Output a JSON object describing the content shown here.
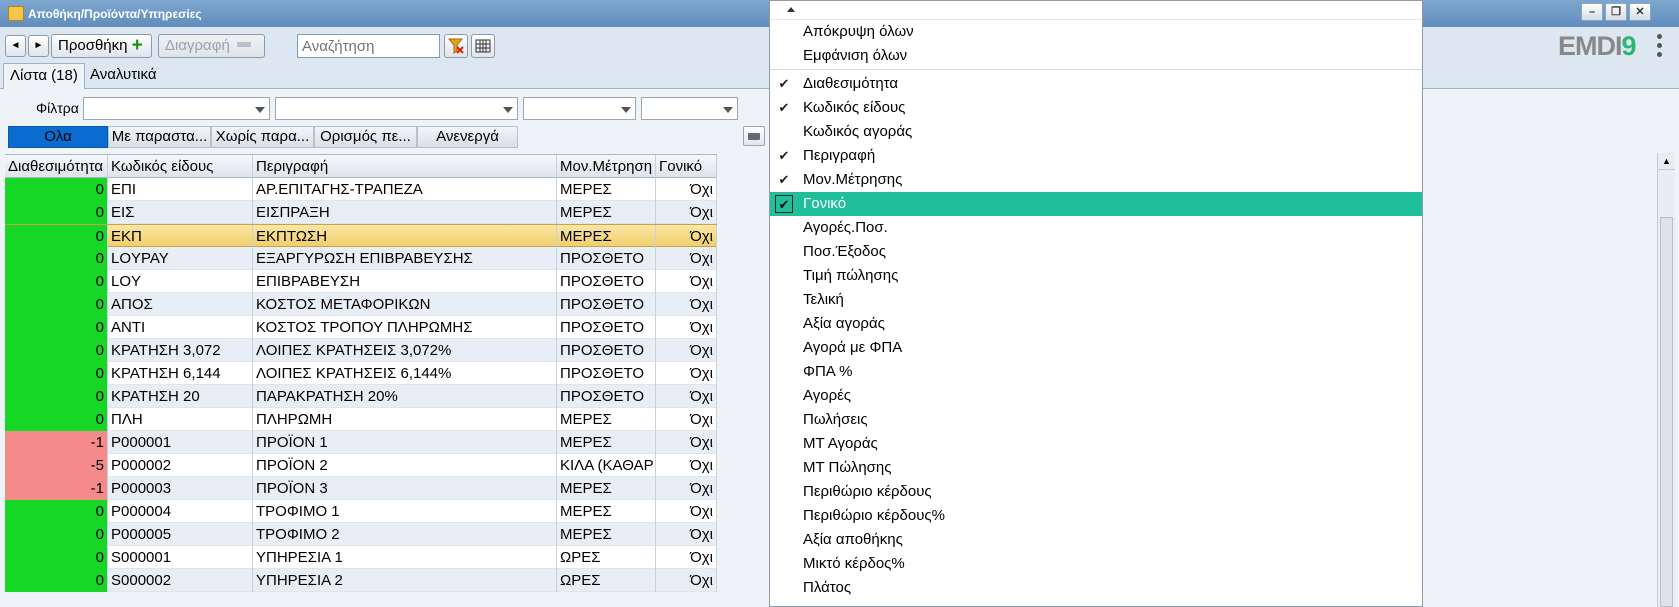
{
  "window": {
    "title": "Αποθήκη/Προϊόντα/Υπηρεσίες"
  },
  "toolbar": {
    "prev_label": "◄",
    "next_label": "►",
    "add_label": "Προσθήκη",
    "delete_label": "Διαγραφή",
    "search_placeholder": "Αναζήτηση"
  },
  "logo": {
    "text_a": "EMDI",
    "text_b": "9"
  },
  "tabs": [
    {
      "label": "Λίστα (18)"
    },
    {
      "label": "Αναλυτικά"
    }
  ],
  "filters": {
    "label": "Φίλτρα",
    "segments": [
      {
        "label": "Ολα"
      },
      {
        "label": "Με παραστα..."
      },
      {
        "label": "Χωρίς παρα..."
      },
      {
        "label": "Ορισμός πε..."
      },
      {
        "label": "Ανενεργά"
      }
    ]
  },
  "grid": {
    "columns": [
      "Διαθεσιμότητα",
      "Κωδικός είδους",
      "Περιγραφή",
      "Μον.Μέτρηση",
      "Γονικό"
    ],
    "rows": [
      {
        "avail": "0",
        "code": "ΕΠΙ",
        "desc": "ΑΡ.ΕΠΙΤΑΓΗΣ-ΤΡΑΠΕΖΑ",
        "unit": "ΜΕΡΕΣ",
        "parent": "Όχι"
      },
      {
        "avail": "0",
        "code": "ΕΙΣ",
        "desc": "ΕΙΣΠΡΑΞΗ",
        "unit": "ΜΕΡΕΣ",
        "parent": "Όχι"
      },
      {
        "avail": "0",
        "code": "ΕΚΠ",
        "desc": "ΕΚΠΤΩΣΗ",
        "unit": "ΜΕΡΕΣ",
        "parent": "Όχι"
      },
      {
        "avail": "0",
        "code": "LOYPAY",
        "desc": "ΕΞΑΡΓΥΡΩΣΗ ΕΠΙΒΡΑΒΕΥΣΗΣ",
        "unit": "ΠΡΟΣΘΕΤΟ",
        "parent": "Όχι"
      },
      {
        "avail": "0",
        "code": "LOY",
        "desc": "ΕΠΙΒΡΑΒΕΥΣΗ",
        "unit": "ΠΡΟΣΘΕΤΟ",
        "parent": "Όχι"
      },
      {
        "avail": "0",
        "code": "ΑΠΟΣ",
        "desc": "ΚΟΣΤΟΣ ΜΕΤΑΦΟΡΙΚΩΝ",
        "unit": "ΠΡΟΣΘΕΤΟ",
        "parent": "Όχι"
      },
      {
        "avail": "0",
        "code": "ΑΝΤΙ",
        "desc": "ΚΟΣΤΟΣ ΤΡΟΠΟΥ ΠΛΗΡΩΜΗΣ",
        "unit": "ΠΡΟΣΘΕΤΟ",
        "parent": "Όχι"
      },
      {
        "avail": "0",
        "code": "ΚΡΑΤΗΣΗ 3,072",
        "desc": "ΛΟΙΠΕΣ ΚΡΑΤΗΣΕΙΣ 3,072%",
        "unit": "ΠΡΟΣΘΕΤΟ",
        "parent": "Όχι"
      },
      {
        "avail": "0",
        "code": "ΚΡΑΤΗΣΗ 6,144",
        "desc": "ΛΟΙΠΕΣ ΚΡΑΤΗΣΕΙΣ 6,144%",
        "unit": "ΠΡΟΣΘΕΤΟ",
        "parent": "Όχι"
      },
      {
        "avail": "0",
        "code": "ΚΡΑΤΗΣΗ 20",
        "desc": "ΠΑΡΑΚΡΑΤΗΣΗ 20%",
        "unit": "ΠΡΟΣΘΕΤΟ",
        "parent": "Όχι"
      },
      {
        "avail": "0",
        "code": "ΠΛΗ",
        "desc": "ΠΛΗΡΩΜΗ",
        "unit": "ΜΕΡΕΣ",
        "parent": "Όχι"
      },
      {
        "avail": "-1",
        "code": "P000001",
        "desc": "ΠΡΟΪΟΝ 1",
        "unit": "ΜΕΡΕΣ",
        "parent": "Όχι"
      },
      {
        "avail": "-5",
        "code": "P000002",
        "desc": "ΠΡΟΪΟΝ 2",
        "unit": "ΚΙΛΑ (ΚΑΘΑΡ",
        "parent": "Όχι"
      },
      {
        "avail": "-1",
        "code": "P000003",
        "desc": "ΠΡΟΪΟΝ 3",
        "unit": "ΜΕΡΕΣ",
        "parent": "Όχι"
      },
      {
        "avail": "0",
        "code": "P000004",
        "desc": "ΤΡΟΦΙΜΟ 1",
        "unit": "ΜΕΡΕΣ",
        "parent": "Όχι"
      },
      {
        "avail": "0",
        "code": "P000005",
        "desc": "ΤΡΟΦΙΜΟ 2",
        "unit": "ΜΕΡΕΣ",
        "parent": "Όχι"
      },
      {
        "avail": "0",
        "code": "S000001",
        "desc": "ΥΠΗΡΕΣΙΑ 1",
        "unit": "ΩΡΕΣ",
        "parent": "Όχι"
      },
      {
        "avail": "0",
        "code": "S000002",
        "desc": "ΥΠΗΡΕΣΙΑ 2",
        "unit": "ΩΡΕΣ",
        "parent": "Όχι"
      }
    ]
  },
  "column_menu": {
    "hide_all": "Απόκρυψη όλων",
    "show_all": "Εμφάνιση όλων",
    "items": [
      {
        "label": "Διαθεσιμότητα",
        "checked": true
      },
      {
        "label": "Κωδικός είδους",
        "checked": true
      },
      {
        "label": "Κωδικός αγοράς",
        "checked": false
      },
      {
        "label": "Περιγραφή",
        "checked": true
      },
      {
        "label": "Μον.Μέτρησης",
        "checked": true
      },
      {
        "label": "Γονικό",
        "checked": true,
        "selected": true
      },
      {
        "label": "Αγορές.Ποσ.",
        "checked": false
      },
      {
        "label": "Ποσ.Έξοδος",
        "checked": false
      },
      {
        "label": "Τιμή πώλησης",
        "checked": false
      },
      {
        "label": "Τελική",
        "checked": false
      },
      {
        "label": "Αξία αγοράς",
        "checked": false
      },
      {
        "label": "Αγορά με ΦΠΑ",
        "checked": false
      },
      {
        "label": "ΦΠΑ %",
        "checked": false
      },
      {
        "label": "Αγορές",
        "checked": false
      },
      {
        "label": "Πωλήσεις",
        "checked": false
      },
      {
        "label": "ΜΤ Αγοράς",
        "checked": false
      },
      {
        "label": "ΜΤ Πώλησης",
        "checked": false
      },
      {
        "label": "Περιθώριο κέρδους",
        "checked": false
      },
      {
        "label": "Περιθώριο κέρδους%",
        "checked": false
      },
      {
        "label": "Αξία αποθήκης",
        "checked": false
      },
      {
        "label": "Μικτό κέρδος%",
        "checked": false
      },
      {
        "label": "Πλάτος",
        "checked": false
      }
    ]
  }
}
